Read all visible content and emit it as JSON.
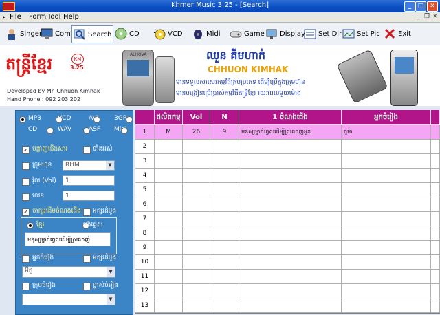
{
  "window": {
    "title": "Khmer Music 3.25 - [Search]"
  },
  "menu": [
    "File",
    "Form",
    "Tool",
    "Help"
  ],
  "toolbar": [
    {
      "label": "Singer",
      "icon": "singer-icon"
    },
    {
      "label": "Com",
      "icon": "computer-icon"
    },
    {
      "label": "Search",
      "icon": "search-icon"
    },
    {
      "label": "CD",
      "icon": "cd-icon"
    },
    {
      "label": "VCD",
      "icon": "vcd-icon"
    },
    {
      "label": "Midi",
      "icon": "midi-icon"
    },
    {
      "label": "Game",
      "icon": "gamepad-icon"
    },
    {
      "label": "Display",
      "icon": "display-icon"
    },
    {
      "label": "Set Dir",
      "icon": "set-dir-icon"
    },
    {
      "label": "Set Pic",
      "icon": "set-pic-icon"
    },
    {
      "label": "Exit",
      "icon": "exit-icon"
    }
  ],
  "banner": {
    "logo_text": "តន្ត្រីខ្មែរ",
    "logo_badge": "KM",
    "version": "3.25",
    "developer": "Developed by Mr. Chhuon Kimhak",
    "phone": "Hand Phone : 092 203 202",
    "name_khmer": "ឈួន  គីមហាក់",
    "name_latin": "CHHUON KIMHAK",
    "line1": "មានទទួលសរសេរកម្មវិធីគ្រប់ប្រភេទ ដើម្បីប្រើក្នុងក្រុមហ៊ុន",
    "line2": "មានបង្រៀនប្រើប្រាស់កម្មវិធីតន្ត្រីខ្មែរ  រយៈពេលមួយម៉ោង",
    "phone_brand": "ALHOVA"
  },
  "filters": {
    "formats": [
      {
        "label": "MP3",
        "selected": true
      },
      {
        "label": "VCD",
        "selected": false
      },
      {
        "label": "AVI",
        "selected": false
      },
      {
        "label": "3GP",
        "selected": false
      },
      {
        "label": "CD",
        "selected": false
      },
      {
        "label": "WAV",
        "selected": false
      },
      {
        "label": "ASF",
        "selected": false
      },
      {
        "label": "Midi",
        "selected": false
      }
    ],
    "show_singers_label": "បង្ហាញជើងសារ",
    "show_all_label": "ទាំងអស់",
    "group_label": "ក្រុមហ៊ុន",
    "group_value": "RHM",
    "vol_label": "វ៉ុល (Vol)",
    "vol_value": "1",
    "number_label": "លេខ",
    "number_value": "1",
    "title_search_label": "ចាក្សរដើមចំណងជើង",
    "title_first_label": "អក្សរដំបូង",
    "khmer_label": "ខ្មែរ",
    "english_label": "អង់គ្លេស",
    "search_value": "មនុស្សម្នាក់ធ្វេសដើម្បីស្រលាញ់",
    "singer_label": "អ្នកចំរៀង",
    "singer_first_label": "អក្សរដំបូង",
    "singer_value": "អីកូ",
    "composer_label": "ក្រុមចំរៀង",
    "composer_first_label": "ម្ចាស់ចំរៀង"
  },
  "table": {
    "headers": [
      "ផលិតកម្ម",
      "Vol",
      "N",
      "1 ចំណងជើង",
      "អ្នកចំរៀង"
    ],
    "rows": [
      {
        "num": "1",
        "prod": "M",
        "vol": "26",
        "n": "9",
        "title": "មនុស្សម្នាក់ធ្វេសដើម្បីស្រលាញ់អូន",
        "singer": "ចូម៉ា"
      },
      {
        "num": "2"
      },
      {
        "num": "3"
      },
      {
        "num": "4"
      },
      {
        "num": "5"
      },
      {
        "num": "6"
      },
      {
        "num": "7"
      },
      {
        "num": "8"
      },
      {
        "num": "9"
      },
      {
        "num": "10"
      },
      {
        "num": "11"
      },
      {
        "num": "12"
      },
      {
        "num": "13"
      }
    ]
  }
}
